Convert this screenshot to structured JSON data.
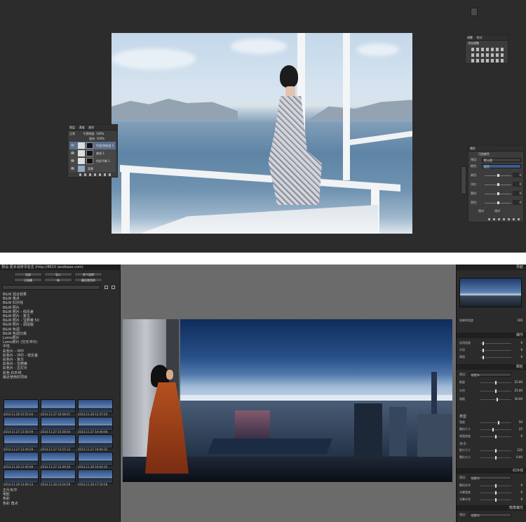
{
  "photoshop": {
    "tool_panel": {
      "tabs": [
        "调整",
        "样式"
      ],
      "heading": "添加调整"
    },
    "layers_panel": {
      "tabs": [
        "图层",
        "通道",
        "路径"
      ],
      "blend_mode": "正常",
      "opacity_label": "不透明度:",
      "opacity_value": "100%",
      "fill_label": "填充:",
      "fill_value": "100%",
      "layers": [
        {
          "name": "色相/饱和度 1",
          "selected": true
        },
        {
          "name": "曲线 1",
          "selected": false
        },
        {
          "name": "色彩平衡 1",
          "selected": false
        },
        {
          "name": "背景",
          "selected": false
        }
      ]
    },
    "properties_panel": {
      "tabs": [
        "属性"
      ],
      "title": "可选颜色",
      "preset_label": "预设:",
      "preset_value": "默认值",
      "colors_label": "颜色:",
      "colors_value": "蓝色",
      "sliders": [
        {
          "label": "青色:",
          "value": "0",
          "pos": 0.5
        },
        {
          "label": "洋红:",
          "value": "0",
          "pos": 0.5
        },
        {
          "label": "黄色:",
          "value": "0",
          "pos": 0.5
        },
        {
          "label": "黑色:",
          "value": "0",
          "pos": 0.5
        }
      ],
      "mode_relative": "相对",
      "mode_absolute": "绝对"
    }
  },
  "lightroom": {
    "window_title": "预设·更多请搜寻名志 (http://8615 landbase.com)",
    "filter_buttons": [
      "全部",
      "导入",
      "多个选择",
      "已收藏",
      "新",
      "最近使用的"
    ],
    "presets": [
      "B&W 混合效果",
      "B&W 角点",
      "B&W 红外线",
      "B&W 照片",
      "B&W 照片 - 低反差",
      "B&W 照片 - 复古",
      "B&W 照片 - 宝丽莱 50",
      "B&W 照片 - 调拍版",
      "B&W 色调",
      "B&W 色调分离",
      "Lomo照片",
      "Lomo照片 (交叉冲印)",
      "中性",
      "彩色片 - 冲印",
      "彩色片 - 冲印 - 低反差",
      "彩色片 - 复古",
      "彩色片 - 宝丽莱",
      "彩色片 - 古灯片",
      "彩色 红外线",
      "最近使用的项目"
    ],
    "thumb_captions": [
      "2014.11.28 15:51:04",
      "2014.11.27 16:58:01",
      "2014.11.28 12:37:20",
      "2014.11.27 13:56:09",
      "2014.11.27 15:58:04",
      "2014.11.27 14:46:08",
      "2014.11.27 13:49:29",
      "2014.11.27 13:15:12",
      "2014.11.27 16:04:35",
      "2014.11.28 12:45:09",
      "2014.11.27 12:49:30",
      "2014.11.28 16:04:35",
      "2014.11.28 14:06:13",
      "2014.11.28 14:24:59",
      "2014.11.28 17:16:58"
    ],
    "bottom_presets": [
      "正片负冲",
      "电影",
      "色彩",
      "色彩 角点"
    ],
    "right_panel": {
      "navigator_header": "导航",
      "exposure_label": "效果的程度",
      "exposure_value": "100",
      "detail_header": "细节",
      "detail_rows": [
        {
          "label": "适用程度",
          "value": "0",
          "pos": 0.1
        },
        {
          "label": "半径",
          "value": "0",
          "pos": 0.1
        },
        {
          "label": "阈值",
          "value": "0",
          "pos": 0.1
        }
      ],
      "grain_header": "颗粒",
      "grain_preset_label": "预设:",
      "grain_preset_value": "自定义",
      "grain_rows": [
        {
          "label": "数量",
          "value": "25.00",
          "pos": 0.5
        },
        {
          "label": "半径",
          "value": "25.00",
          "pos": 0.5
        },
        {
          "label": "粗糙",
          "value": "30.00",
          "pos": 0.55
        }
      ],
      "type_header": "类型",
      "type_rows": [
        {
          "label": "强度",
          "value": "50",
          "pos": 0.6
        },
        {
          "label": "颗粒尺寸",
          "value": "25",
          "pos": 0.4
        },
        {
          "label": "增强程度",
          "value": "0",
          "pos": 0.5
        }
      ],
      "size_label": "大小",
      "size_rows": [
        {
          "label": "影片尺寸",
          "value": "135",
          "pos": 0.5
        },
        {
          "label": "颗粒大小",
          "value": "0.00",
          "pos": 0.5
        }
      ],
      "infrared_header": "红外线",
      "infrared_preset_label": "预设:",
      "infrared_preset_value": "自定义",
      "infrared_rows": [
        {
          "label": "颗粒技术",
          "value": "0",
          "pos": 0.5
        },
        {
          "label": "光晕强度",
          "value": "0",
          "pos": 0.5
        },
        {
          "label": "光晕半径",
          "value": "0",
          "pos": 0.5
        }
      ],
      "vignette_header": "暗角偏光",
      "vignette_preset_label": "预设:",
      "vignette_preset_value": "自定义"
    }
  }
}
